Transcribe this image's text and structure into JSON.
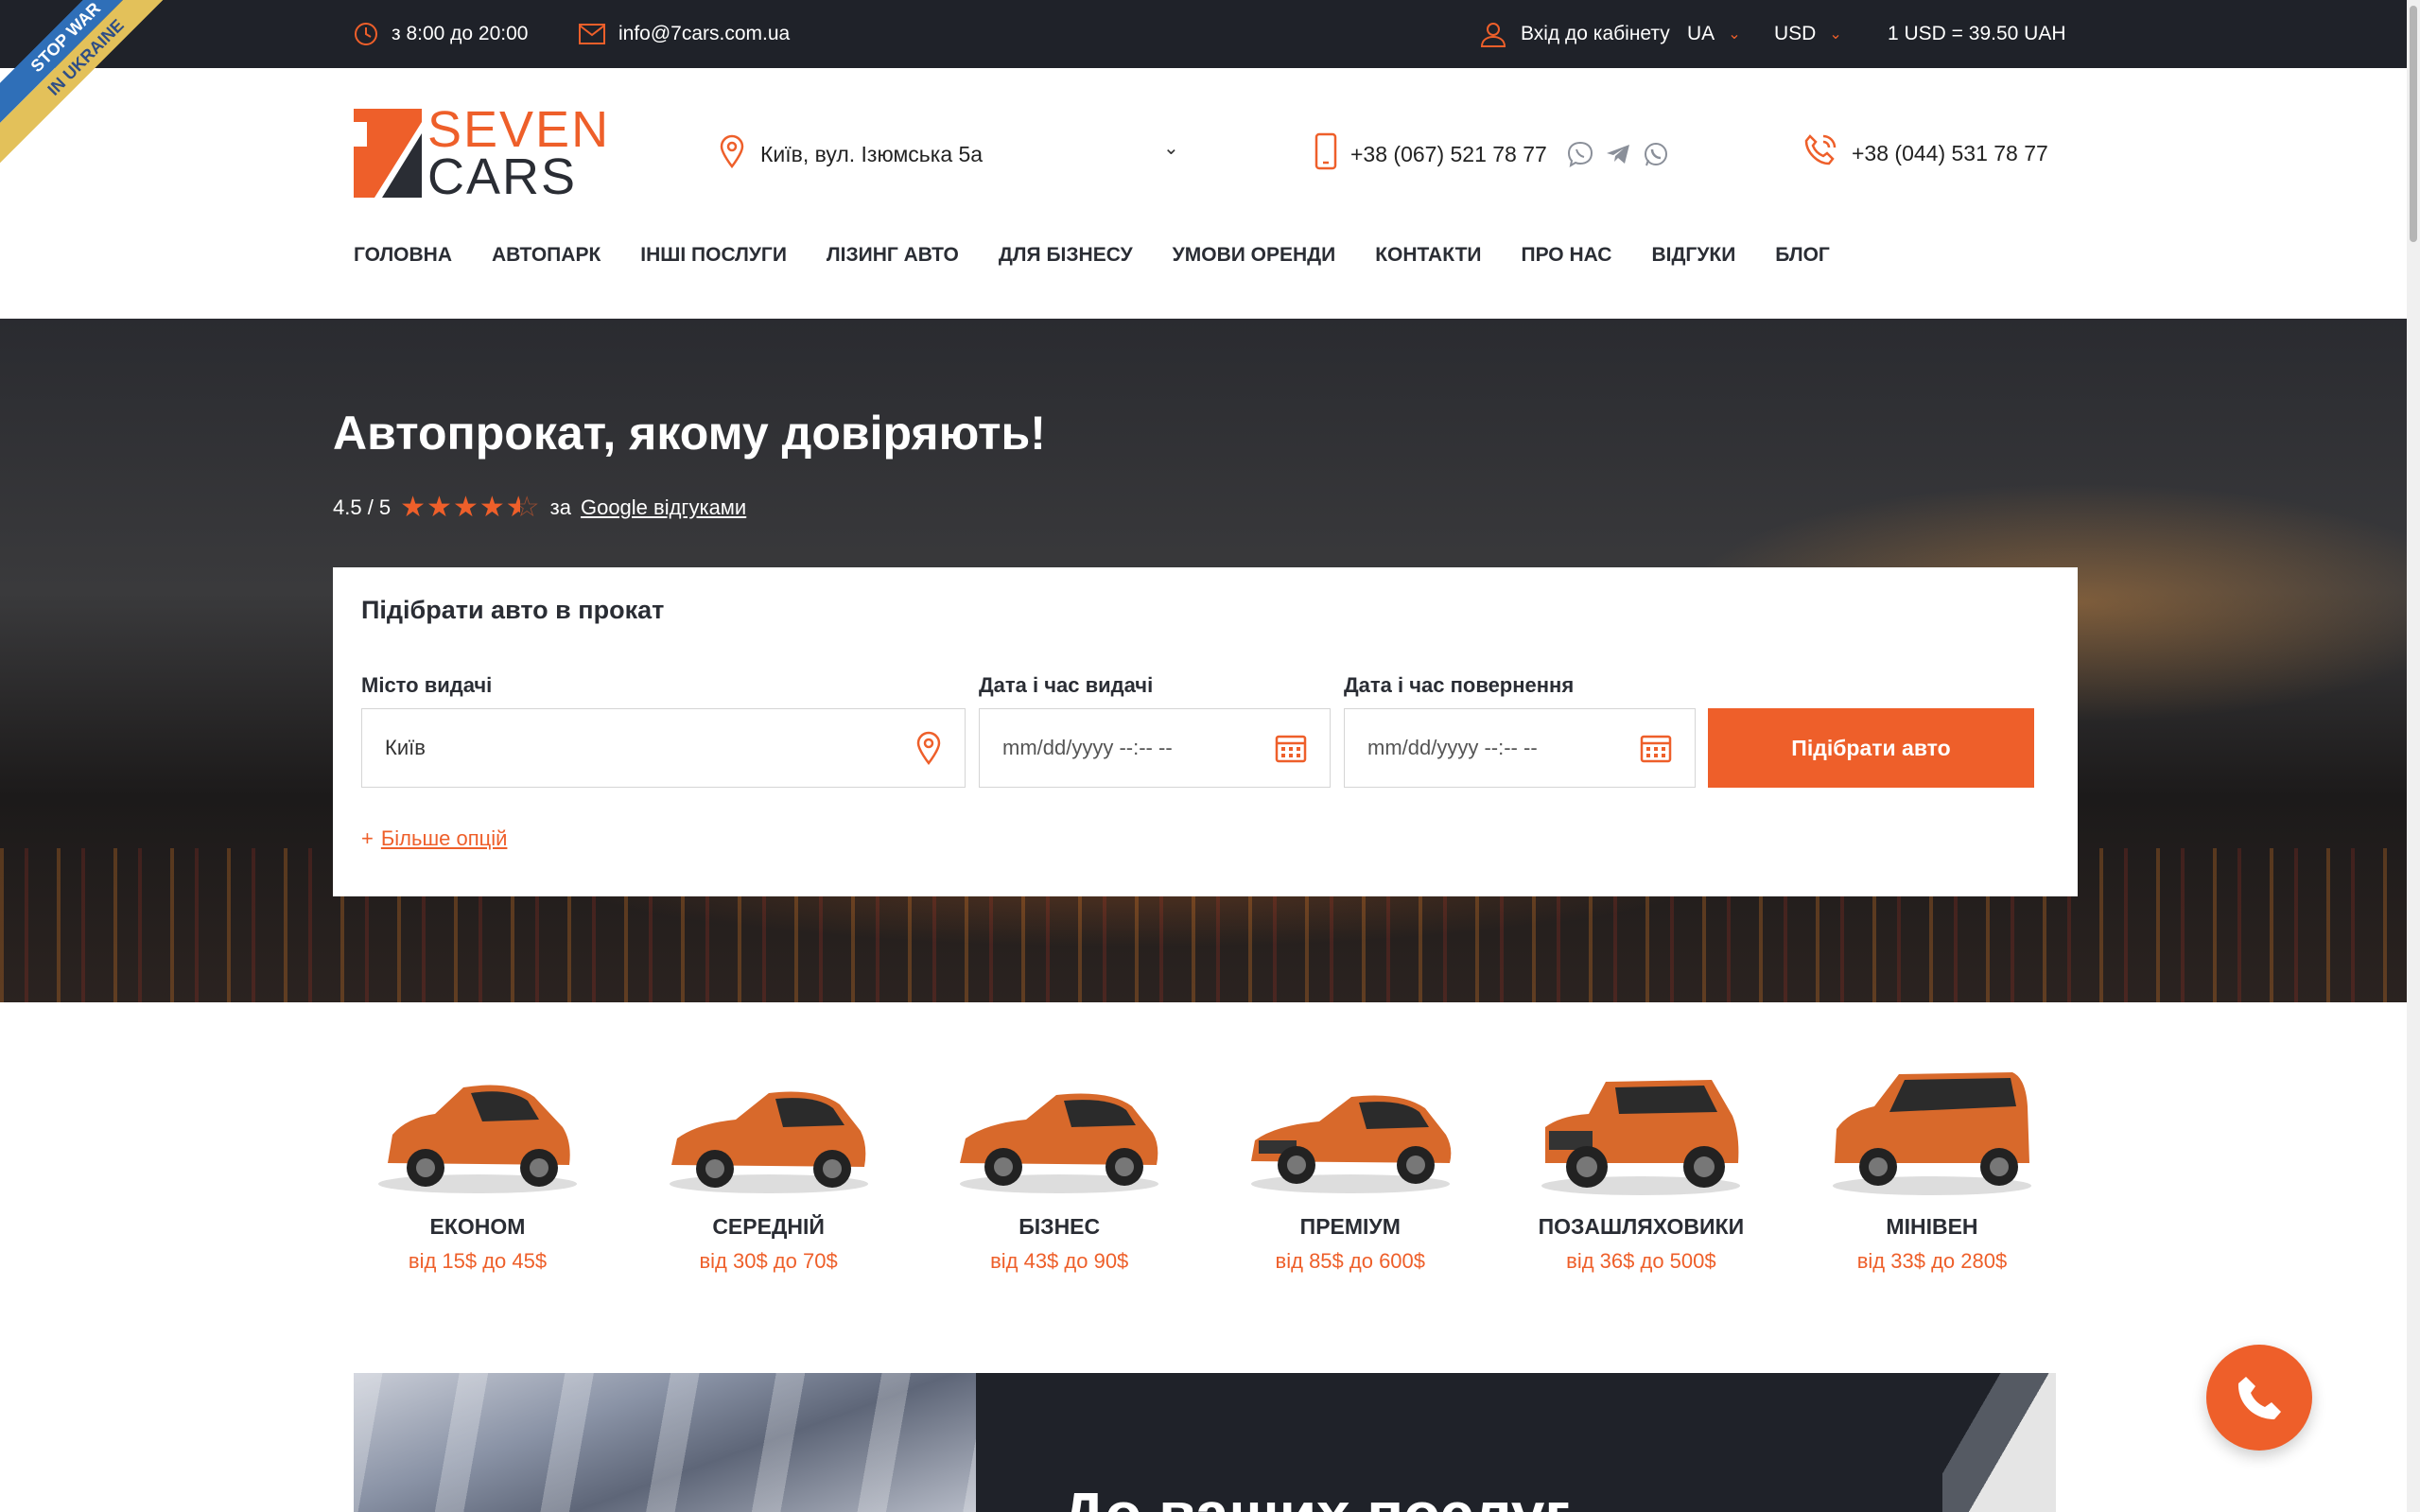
{
  "colors": {
    "accent": "#ee5f2a",
    "topbar_bg": "#1f2229",
    "text_dark": "#2a2d34"
  },
  "ribbon": {
    "line1": "STOP WAR",
    "line2": "IN UKRAINE"
  },
  "topbar": {
    "hours": "з 8:00 до 20:00",
    "email": "info@7cars.com.ua",
    "login": "Вхід до кабінету",
    "language": "UA",
    "currency": "USD",
    "rate": "1 USD = 39.50 UAH"
  },
  "header": {
    "logo_line1": "SEVEN",
    "logo_line2": "CARS",
    "address": "Київ, вул. Ізюмська 5а",
    "phone_mobile": "+38 (067) 521 78 77",
    "phone_office": "+38 (044) 531 78 77",
    "messengers": [
      "viber-icon",
      "telegram-icon",
      "whatsapp-icon"
    ]
  },
  "nav": [
    {
      "label": "ГОЛОВНА"
    },
    {
      "label": "АВТОПАРК"
    },
    {
      "label": "ІНШІ ПОСЛУГИ"
    },
    {
      "label": "ЛІЗИНГ АВТО"
    },
    {
      "label": "ДЛЯ БІЗНЕСУ"
    },
    {
      "label": "УМОВИ ОРЕНДИ"
    },
    {
      "label": "КОНТАКТИ"
    },
    {
      "label": "ПРО НАС"
    },
    {
      "label": "ВІДГУКИ"
    },
    {
      "label": "БЛОГ"
    }
  ],
  "hero": {
    "title": "Автопрокат, якому довіряють!",
    "rating_value": "4.5 / 5",
    "rating_stars": 4.5,
    "rating_prefix": "за",
    "rating_link": "Google відгуками"
  },
  "search": {
    "title": "Підібрати авто в прокат",
    "city_label": "Місто видачі",
    "city_value": "Київ",
    "pickup_label": "Дата і час видачі",
    "pickup_placeholder": "mm/dd/yyyy  --:-- --",
    "return_label": "Дата і час повернення",
    "return_placeholder": "mm/dd/yyyy  --:-- --",
    "button": "Підібрати авто",
    "more_options": "Більше опцій"
  },
  "categories": [
    {
      "name": "ЕКОНОМ",
      "price": "від 15$ до 45$"
    },
    {
      "name": "СЕРЕДНІЙ",
      "price": "від 30$ до 70$"
    },
    {
      "name": "БІЗНЕС",
      "price": "від 43$ до 90$"
    },
    {
      "name": "ПРЕМІУМ",
      "price": "від 85$ до 600$"
    },
    {
      "name": "ПОЗАШЛЯХОВИКИ",
      "price": "від 36$ до 500$"
    },
    {
      "name": "МІНІВЕН",
      "price": "від 33$ до 280$"
    }
  ],
  "banner": {
    "title": "До ваших послуг"
  }
}
